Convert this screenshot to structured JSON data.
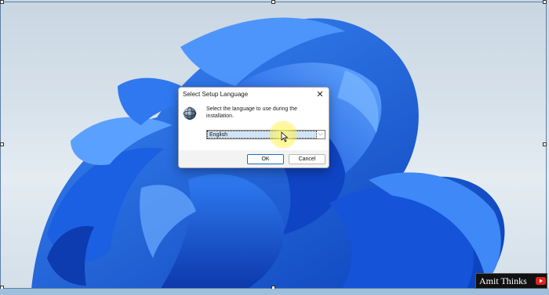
{
  "dialog": {
    "title": "Select Setup Language",
    "close_glyph": "✕",
    "icon": "globe-icon",
    "message": "Select the language to use during the installation.",
    "language_selected": "English",
    "dropdown_glyph": "⌵",
    "ok_label": "OK",
    "cancel_label": "Cancel"
  },
  "watermark": {
    "text": "Amit Thinks",
    "icon": "youtube-icon"
  },
  "colors": {
    "accent": "#1a6fc4",
    "bloom_dark": "#0a3fb8",
    "bloom_light": "#3d8af7",
    "highlight": "#fff24f"
  }
}
